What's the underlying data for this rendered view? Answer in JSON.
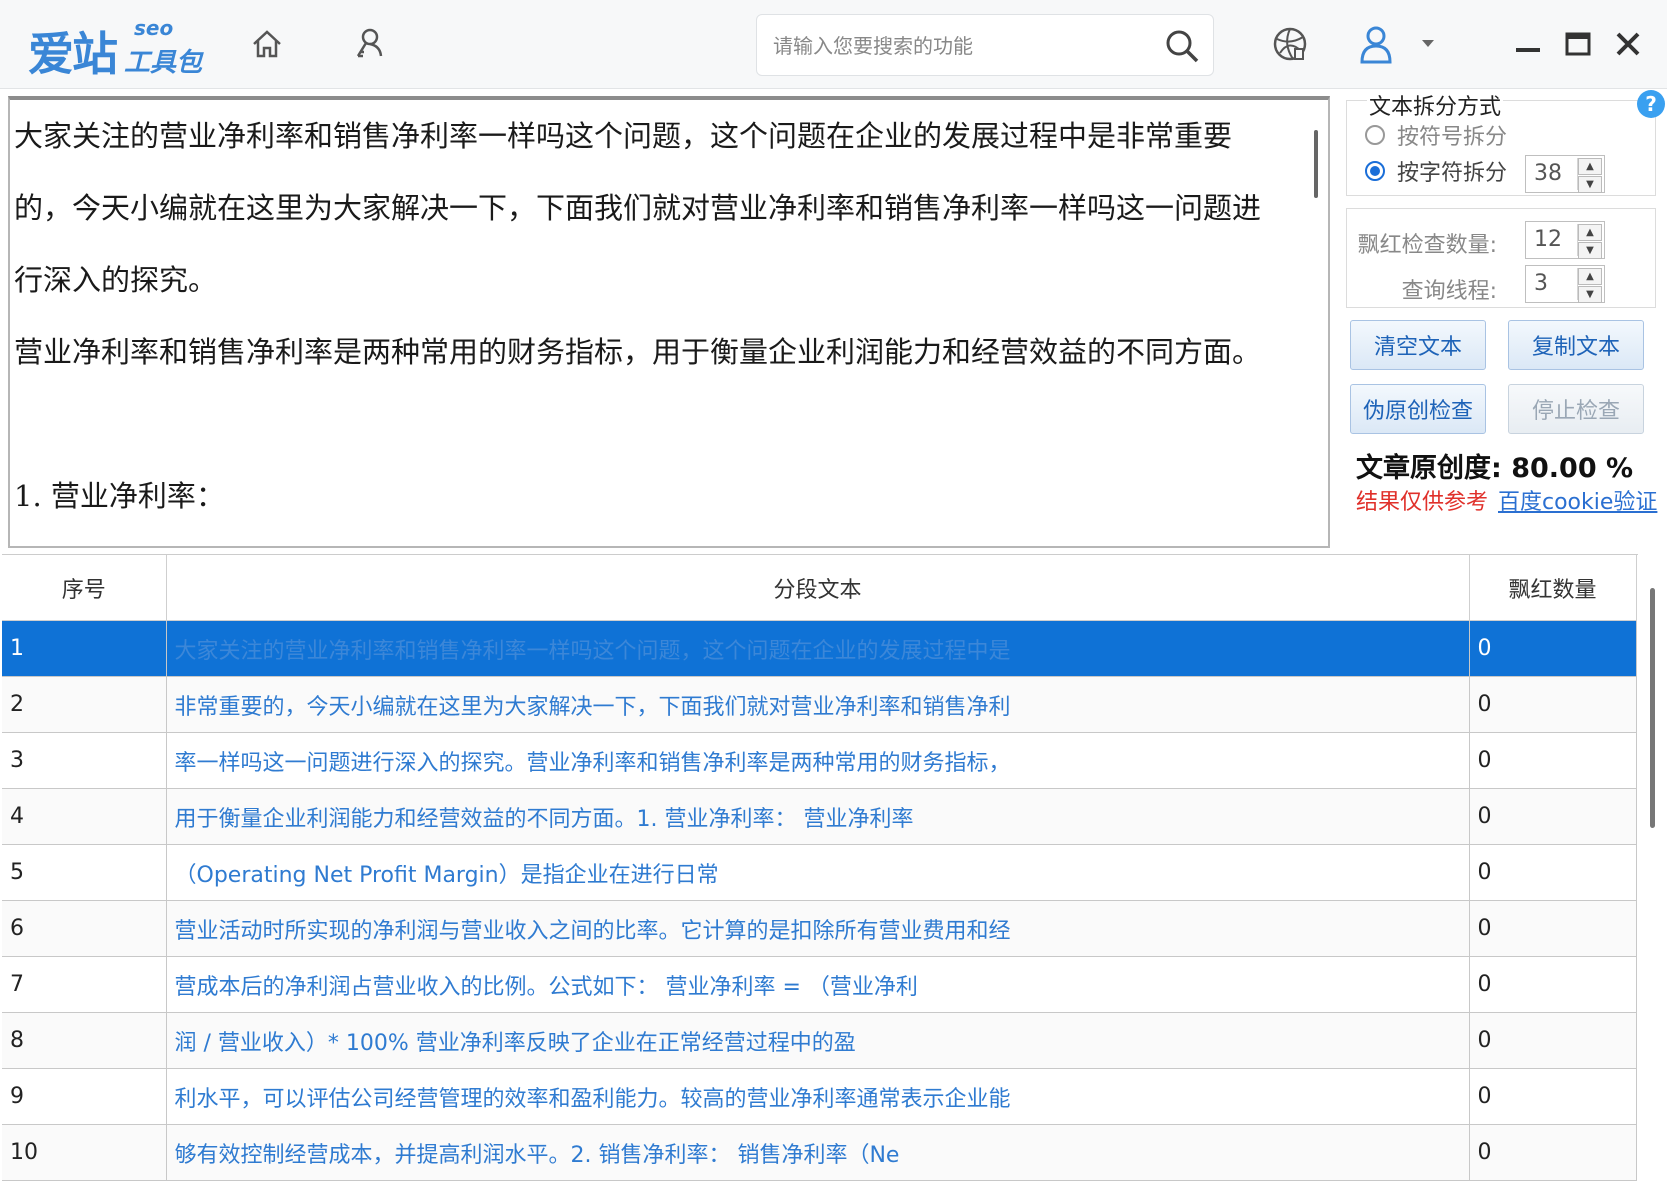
{
  "header": {
    "logo_main": "爱站",
    "logo_seo": "seo",
    "logo_sub": "工具包",
    "search_placeholder": "请输入您要搜索的功能",
    "icons": [
      "home-icon",
      "user-key-icon",
      "search-icon",
      "globe-icon",
      "user-icon",
      "dropdown-arrow-icon",
      "minimize-icon",
      "maximize-icon",
      "close-icon"
    ]
  },
  "editor": {
    "paragraphs": [
      "大家关注的营业净利率和销售净利率一样吗这个问题，这个问题在企业的发展过程中是非常重要",
      "的，今天小编就在这里为大家解决一下，下面我们就对营业净利率和销售净利率一样吗这一问题进",
      "行深入的探究。",
      "营业净利率和销售净利率是两种常用的财务指标，用于衡量企业利润能力和经营效益的不同方面。",
      "",
      "1.  营业净利率："
    ]
  },
  "settings": {
    "split_group_title": "文本拆分方式",
    "option_symbol": "按符号拆分",
    "option_char": "按字符拆分",
    "selected_option": "按字符拆分",
    "char_count": "38",
    "red_check_label": "飘红检查数量:",
    "red_check_value": "12",
    "thread_label": "查询线程:",
    "thread_value": "3",
    "btn_clear": "清空文本",
    "btn_copy": "复制文本",
    "btn_check": "伪原创检查",
    "btn_stop": "停止检查",
    "originality": "文章原创度: 80.00 %",
    "note": "结果仅供参考",
    "cookie_link": "百度cookie验证",
    "help": "?",
    "accent_color": "#0f72d6",
    "warning_color": "#e0302a"
  },
  "table": {
    "headers": [
      "序号",
      "分段文本",
      "飘红数量"
    ],
    "rows": [
      {
        "idx": "1",
        "text": "大家关注的营业净利率和销售净利率一样吗这个问题，这个问题在企业的发展过程中是",
        "count": "0",
        "selected": true
      },
      {
        "idx": "2",
        "text": "非常重要的，今天小编就在这里为大家解决一下，下面我们就对营业净利率和销售净利",
        "count": "0"
      },
      {
        "idx": "3",
        "text": "率一样吗这一问题进行深入的探究。营业净利率和销售净利率是两种常用的财务指标，",
        "count": "0"
      },
      {
        "idx": "4",
        "text": "用于衡量企业利润能力和经营效益的不同方面。1. 营业净利率：    营业净利率",
        "count": "0"
      },
      {
        "idx": "5",
        "text": "（Operating Net Profit Margin）是指企业在进行日常",
        "count": "0"
      },
      {
        "idx": "6",
        "text": "营业活动时所实现的净利润与营业收入之间的比率。它计算的是扣除所有营业费用和经",
        "count": "0"
      },
      {
        "idx": "7",
        "text": "营成本后的净利润占营业收入的比例。公式如下：    营业净利率 = （营业净利",
        "count": "0"
      },
      {
        "idx": "8",
        "text": "润 / 营业收入）* 100%    营业净利率反映了企业在正常经营过程中的盈",
        "count": "0"
      },
      {
        "idx": "9",
        "text": "利水平，可以评估公司经营管理的效率和盈利能力。较高的营业净利率通常表示企业能",
        "count": "0"
      },
      {
        "idx": "10",
        "text": "够有效控制经营成本，并提高利润水平。2. 销售净利率：    销售净利率（Ne",
        "count": "0"
      }
    ]
  }
}
